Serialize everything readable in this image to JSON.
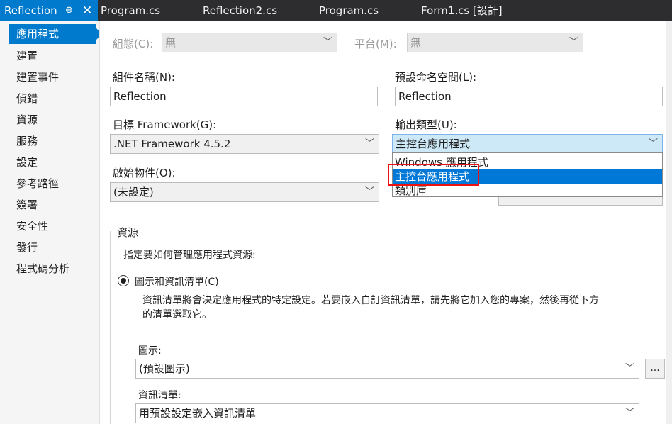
{
  "tabs": [
    {
      "label": "Reflection",
      "active": true
    },
    {
      "label": "Program.cs"
    },
    {
      "label": "Reflection2.cs"
    },
    {
      "label": "Program.cs"
    },
    {
      "label": "Form1.cs [設計]"
    }
  ],
  "tab_icons": {
    "pin": "⊕",
    "close": "✕"
  },
  "sidebar": {
    "items": [
      {
        "label": "應用程式",
        "selected": true
      },
      {
        "label": "建置"
      },
      {
        "label": "建置事件"
      },
      {
        "label": "偵錯"
      },
      {
        "label": "資源"
      },
      {
        "label": "服務"
      },
      {
        "label": "設定"
      },
      {
        "label": "參考路徑"
      },
      {
        "label": "簽署"
      },
      {
        "label": "安全性"
      },
      {
        "label": "發行"
      },
      {
        "label": "程式碼分析"
      }
    ]
  },
  "config": {
    "config_label": "組態(C):",
    "config_value": "無",
    "platform_label": "平台(M):",
    "platform_value": "無"
  },
  "assembly": {
    "label": "組件名稱(N):",
    "value": "Reflection"
  },
  "namespace": {
    "label": "預設命名空間(L):",
    "value": "Reflection"
  },
  "framework": {
    "label": "目標 Framework(G):",
    "value": ".NET Framework 4.5.2"
  },
  "output_type": {
    "label": "輸出類型(U):",
    "value": "主控台應用程式",
    "options": [
      "Windows 應用程式",
      "主控台應用程式",
      "類別庫"
    ],
    "selected_index": 1
  },
  "startup": {
    "label": "啟始物件(O):",
    "value": "(未設定)"
  },
  "resources": {
    "group_title": "資源",
    "instruction": "指定要如何管理應用程式資源:",
    "radio_label": "圖示和資訊清單(C)",
    "description_line1": "資訊清單將會決定應用程式的特定設定。若要嵌入自訂資訊清單，請先將它加入您的專案，然後再從下方",
    "description_line2": "的清單選取它。",
    "icon_label": "圖示:",
    "icon_value": "(預設圖示)",
    "browse_label": "...",
    "manifest_label": "資訊清單:",
    "manifest_value": "用預設設定嵌入資訊清單"
  },
  "colors": {
    "accent": "#007acc",
    "tabbar": "#2d2d30",
    "selection": "#0078d7",
    "highlight_box": "#e11111"
  }
}
